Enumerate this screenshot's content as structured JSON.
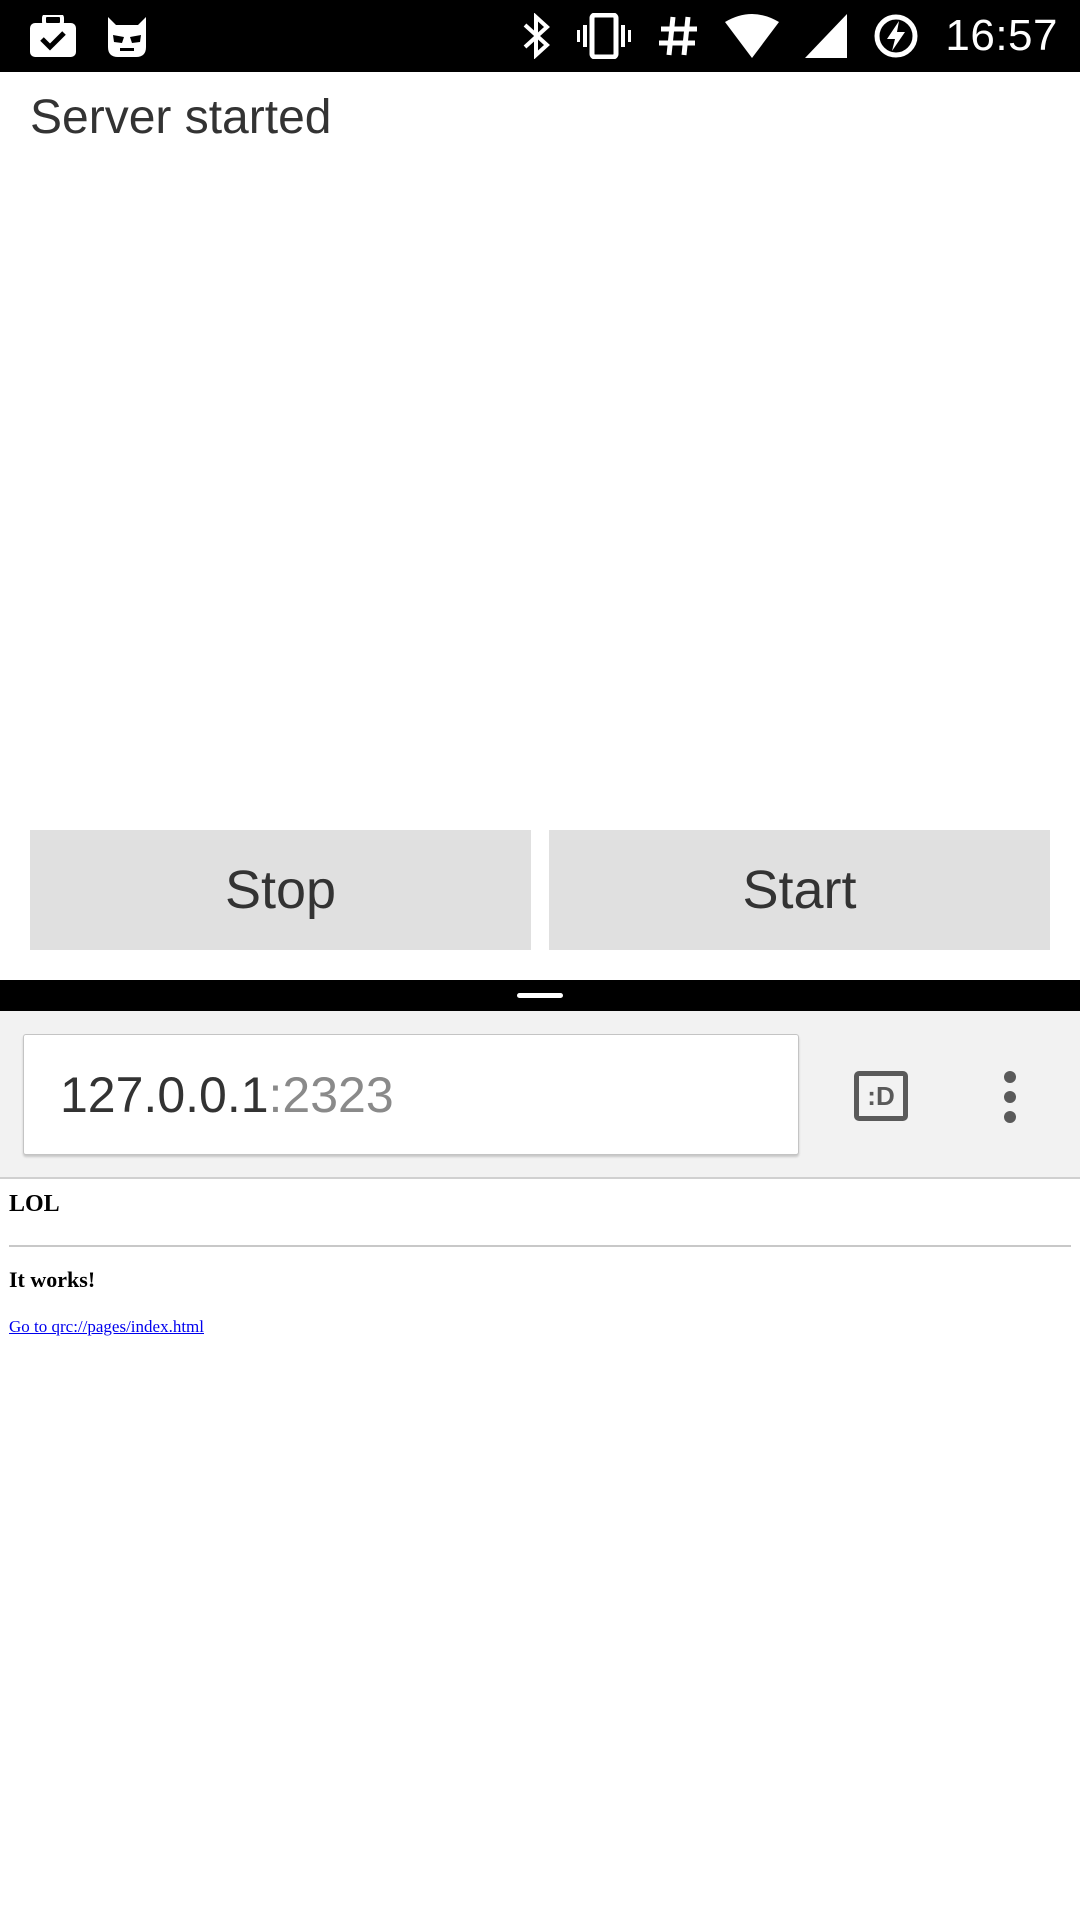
{
  "status_bar": {
    "time": "16:57",
    "icons": [
      "briefcase-check-icon",
      "cyanogen-mascot-icon",
      "bluetooth-icon",
      "vibrate-icon",
      "hash-icon",
      "wifi-icon",
      "cell-signal-icon",
      "battery-charging-icon"
    ]
  },
  "app": {
    "status_text": "Server started",
    "stop_label": "Stop",
    "start_label": "Start",
    "button_color": "#e0e0e0"
  },
  "browser": {
    "url_host": "127.0.0.1",
    "url_port": ":2323",
    "tab_switcher_label": ":D",
    "menu_icon": "overflow-menu-icon"
  },
  "web_page": {
    "heading": "LOL",
    "subheading": "It works!",
    "link_text": "Go to qrc://pages/index.html",
    "link_color": "#0000ee"
  }
}
